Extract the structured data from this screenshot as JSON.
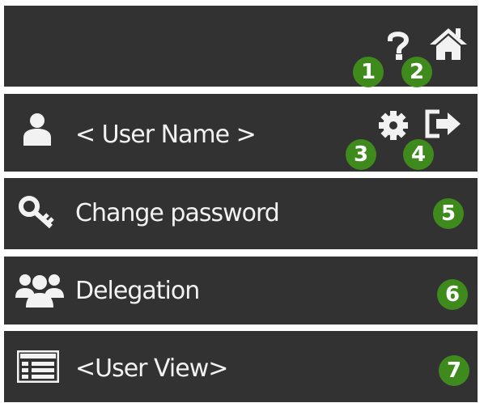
{
  "header": {
    "help_icon": "help-icon",
    "home_icon": "home-icon",
    "help_badge": "1",
    "home_badge": "2"
  },
  "user_row": {
    "user_name": "< User Name >",
    "settings_badge": "3",
    "logout_badge": "4"
  },
  "menu": {
    "change_password": {
      "label": "Change password",
      "badge": "5"
    },
    "delegation": {
      "label": "Delegation",
      "badge": "6"
    },
    "user_view": {
      "label": "<User View>",
      "badge": "7"
    }
  },
  "colors": {
    "panel": "#323232",
    "separator": "#cfcfcf",
    "badge": "#3e8a1c",
    "text": "#f2f2f2"
  }
}
